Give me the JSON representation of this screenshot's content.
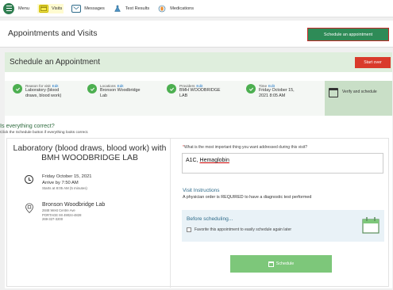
{
  "nav": {
    "menu": "Menu",
    "visits": "Visits",
    "messages": "Messages",
    "test_results": "Test Results",
    "medications": "Medications"
  },
  "header": {
    "title": "Appointments and Visits",
    "schedule_button": "Schedule an appointment"
  },
  "card": {
    "title": "Schedule an Appointment",
    "start_over": "Start over"
  },
  "steps": [
    {
      "label": "Reason for visit",
      "edit": "Edit",
      "value_line1": "Laboratory (blood",
      "value_line2": "draws, blood work)"
    },
    {
      "label": "Locations",
      "edit": "Edit",
      "value_line1": "Bronson Woodbridge",
      "value_line2": "Lab"
    },
    {
      "label": "Providers",
      "edit": "Edit",
      "value_line1": "BMH WOODBRIDGE",
      "value_line2": "LAB"
    },
    {
      "label": "Time",
      "edit": "Edit",
      "value_line1": "Friday October 15,",
      "value_line2": "2021 8:05 AM"
    }
  ],
  "verify": "Verify and schedule",
  "confirm": {
    "question": "Is everything correct?",
    "sub": "Click the Schedule button if everything looks correct."
  },
  "appointment": {
    "title": "Laboratory (blood draws, blood work) with BMH WOODBRIDGE LAB",
    "date": "Friday October 15, 2021",
    "arrive": "Arrive by 7:50 AM",
    "starts": "Starts at 8:05 AM (5 minutes)",
    "location_name": "Bronson Woodbridge Lab",
    "address1": "2848 West Centre Ave",
    "address2": "PORTAGE MI 49024-4828",
    "phone": "269-327-3200"
  },
  "form": {
    "question_star": "*",
    "question": "What is the most important thing you want addressed during this visit?",
    "answer_plain": "A1C, ",
    "answer_marked": "Hemaglobin",
    "visit_instructions_title": "Visit Instructions",
    "visit_instructions_text": "A physician order is REQUIRED to have a diagnostic test performed",
    "before_title": "Before scheduling...",
    "favorite_label": "Favorite this appointment to easily schedule again later",
    "schedule_button": "Schedule"
  },
  "colors": {
    "brand_green": "#2e8b57",
    "alert_red": "#d93a2b",
    "link_blue": "#1a73c4"
  }
}
